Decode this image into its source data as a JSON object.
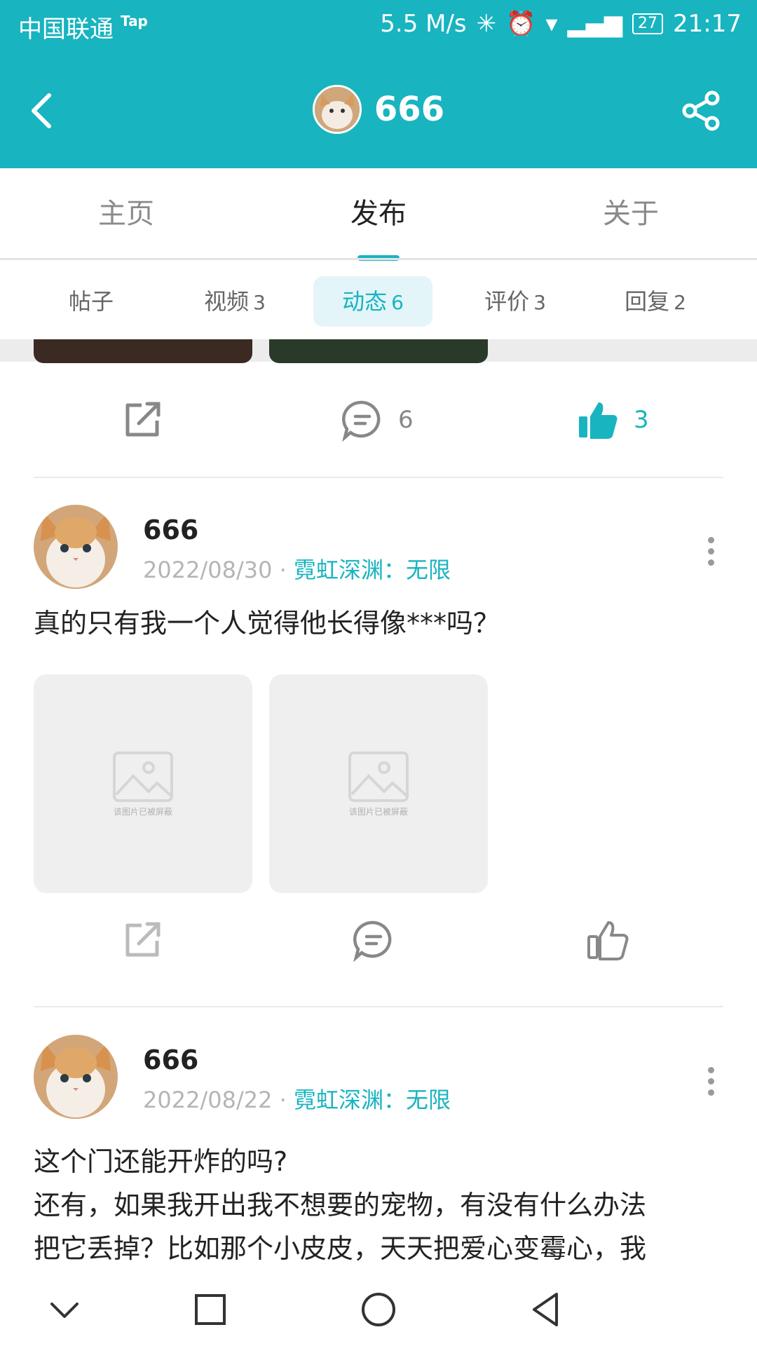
{
  "status_bar": {
    "carrier": "中国联通",
    "carrier_badge": "Tap",
    "speed": "5.5 M/s",
    "battery": "27",
    "time": "21:17"
  },
  "header": {
    "title": "666",
    "back_icon": "chevron-left-icon",
    "share_icon": "share-icon"
  },
  "tabs": [
    "主页",
    "发布",
    "关于"
  ],
  "active_tab": "发布",
  "subtabs": [
    {
      "label": "帖子",
      "count": ""
    },
    {
      "label": "视频",
      "count": "3"
    },
    {
      "label": "动态",
      "count": "6"
    },
    {
      "label": "评价",
      "count": "3"
    },
    {
      "label": "回复",
      "count": "2"
    }
  ],
  "active_subtab": "动态",
  "first_actions": {
    "comment_count": "6",
    "like_count": "3"
  },
  "posts": [
    {
      "author": "666",
      "date": "2022/08/30",
      "game": "霓虹深渊：无限",
      "text": "真的只有我一个人觉得他长得像***吗？",
      "blocked_images": [
        "该图片已被屏蔽",
        "该图片已被屏蔽"
      ]
    },
    {
      "author": "666",
      "date": "2022/08/22",
      "game": "霓虹深渊：无限",
      "text_lines": [
        "这个门还能开炸的吗?",
        "还有，如果我开出我不想要的宠物，有没有什么办法",
        "把它丢掉？比如那个小皮皮，天天把爱心变霉心，我"
      ]
    }
  ],
  "colors": {
    "accent": "#18b4c0",
    "muted": "#b5b5b5"
  }
}
